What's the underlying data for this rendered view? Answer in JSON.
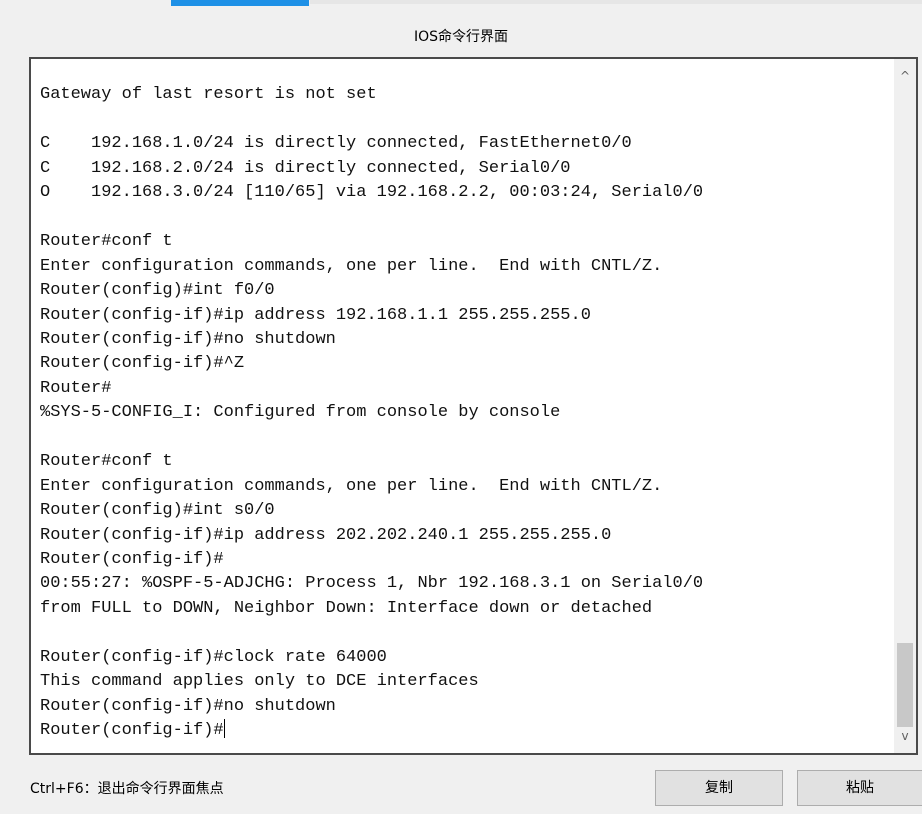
{
  "window": {
    "title": "IOS命令行界面"
  },
  "terminal": {
    "lines": [
      "",
      "Gateway of last resort is not set",
      "",
      "C    192.168.1.0/24 is directly connected, FastEthernet0/0",
      "C    192.168.2.0/24 is directly connected, Serial0/0",
      "O    192.168.3.0/24 [110/65] via 192.168.2.2, 00:03:24, Serial0/0",
      "",
      "Router#conf t",
      "Enter configuration commands, one per line.  End with CNTL/Z.",
      "Router(config)#int f0/0",
      "Router(config-if)#ip address 192.168.1.1 255.255.255.0",
      "Router(config-if)#no shutdown",
      "Router(config-if)#^Z",
      "Router#",
      "%SYS-5-CONFIG_I: Configured from console by console",
      "",
      "Router#conf t",
      "Enter configuration commands, one per line.  End with CNTL/Z.",
      "Router(config)#int s0/0",
      "Router(config-if)#ip address 202.202.240.1 255.255.255.0",
      "Router(config-if)#",
      "00:55:27: %OSPF-5-ADJCHG: Process 1, Nbr 192.168.3.1 on Serial0/0",
      "from FULL to DOWN, Neighbor Down: Interface down or detached",
      "",
      "Router(config-if)#clock rate 64000",
      "This command applies only to DCE interfaces",
      "Router(config-if)#no shutdown",
      "Router(config-if)#"
    ]
  },
  "scrollbar": {
    "up_icon": "chevron-up-icon",
    "up_glyph": "^",
    "down_icon": "chevron-down-icon",
    "down_glyph": "v"
  },
  "footer": {
    "hint": "Ctrl+F6：退出命令行界面焦点",
    "copy_label": "复制",
    "paste_label": "粘贴"
  },
  "colors": {
    "active_tab": "#1e90e6",
    "terminal_bg": "#ffffff",
    "window_bg": "#f0f0f0"
  }
}
